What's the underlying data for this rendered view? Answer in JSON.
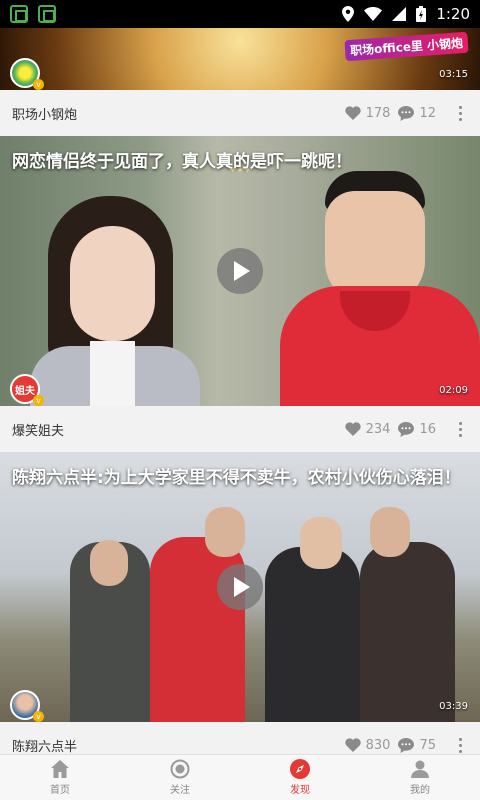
{
  "status": {
    "time": "1:20"
  },
  "feed": [
    {
      "title": "",
      "author": "职场小钢炮",
      "likes": "178",
      "comments": "12",
      "duration": "03:15",
      "brand_text": "职场office里 小钢炮"
    },
    {
      "title": "网恋情侣终于见面了，真人真的是吓一跳呢！",
      "author": "爆笑姐夫",
      "likes": "234",
      "comments": "16",
      "duration": "02:09",
      "avatar_text": "姐夫"
    },
    {
      "title": "陈翔六点半:为上大学家里不得不卖牛，农村小伙伤心落泪！",
      "author": "陈翔六点半",
      "likes": "830",
      "comments": "75",
      "duration": "03:39"
    }
  ],
  "tabs": [
    {
      "label": "首页",
      "icon": "home-icon"
    },
    {
      "label": "关注",
      "icon": "follow-icon"
    },
    {
      "label": "发现",
      "icon": "compass-icon",
      "active": true
    },
    {
      "label": "我的",
      "icon": "profile-icon"
    }
  ],
  "colors": {
    "accent": "#e53935",
    "badge": "#f5b400"
  }
}
